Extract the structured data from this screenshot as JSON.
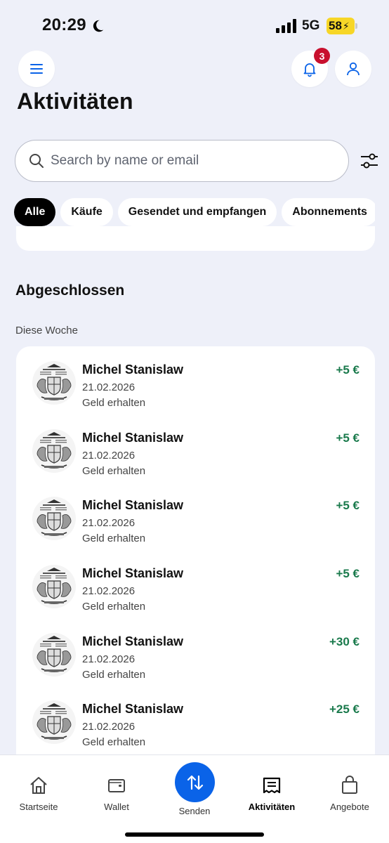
{
  "status_bar": {
    "time": "20:29",
    "network": "5G",
    "battery": "58"
  },
  "header": {
    "notification_count": "3",
    "title": "Aktivitäten"
  },
  "search": {
    "placeholder": "Search by name or email"
  },
  "filters": [
    "Alle",
    "Käufe",
    "Gesendet und empfangen",
    "Abonnements"
  ],
  "section": {
    "heading": "Abgeschlossen",
    "subheading": "Diese Woche"
  },
  "transactions": [
    {
      "name": "Michel Stanislaw",
      "date": "21.02.2026",
      "type": "Geld erhalten",
      "amount": "+5 €"
    },
    {
      "name": "Michel Stanislaw",
      "date": "21.02.2026",
      "type": "Geld erhalten",
      "amount": "+5 €"
    },
    {
      "name": "Michel Stanislaw",
      "date": "21.02.2026",
      "type": "Geld erhalten",
      "amount": "+5 €"
    },
    {
      "name": "Michel Stanislaw",
      "date": "21.02.2026",
      "type": "Geld erhalten",
      "amount": "+5 €"
    },
    {
      "name": "Michel Stanislaw",
      "date": "21.02.2026",
      "type": "Geld erhalten",
      "amount": "+30 €"
    },
    {
      "name": "Michel Stanislaw",
      "date": "21.02.2026",
      "type": "Geld erhalten",
      "amount": "+25 €"
    }
  ],
  "nav": {
    "home": "Startseite",
    "wallet": "Wallet",
    "send": "Senden",
    "activity": "Aktivitäten",
    "offers": "Angebote"
  },
  "colors": {
    "accent": "#0a63e8",
    "positive": "#1a7a4c",
    "badge": "#c8102e",
    "background": "#eef0f9"
  },
  "icons": {
    "menu": "hamburger-menu-icon",
    "bell": "bell-icon",
    "profile": "user-icon",
    "search": "search-icon",
    "filter": "filter-sliders-icon",
    "avatar": "coat-of-arms-avatar",
    "home": "home-icon",
    "wallet": "wallet-icon",
    "send": "swap-arrows-icon",
    "activity": "receipt-icon",
    "offers": "shopping-bag-icon"
  }
}
